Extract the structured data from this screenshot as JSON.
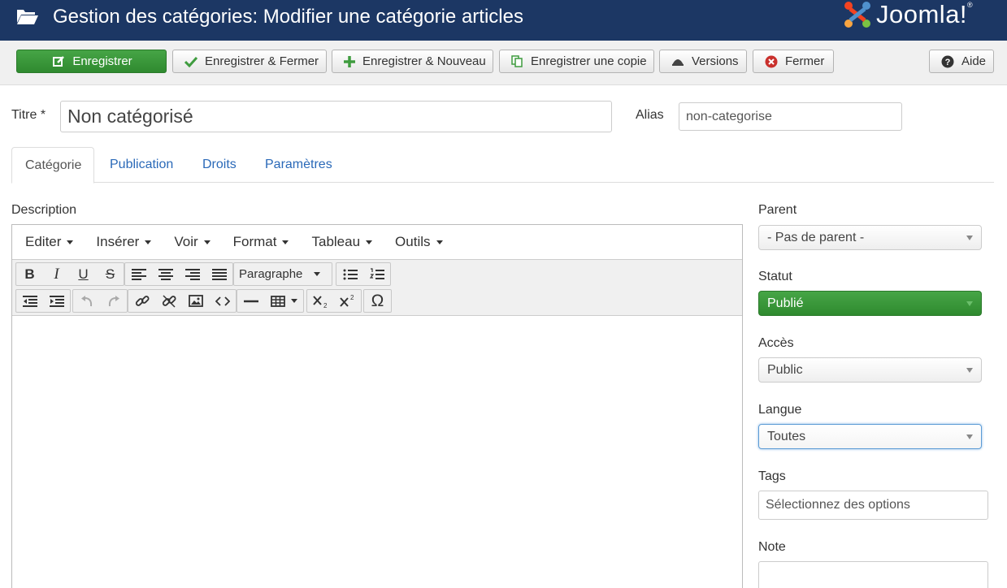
{
  "header": {
    "title": "Gestion des catégories: Modifier une catégorie articles",
    "logo_text": "Joomla!",
    "logo_reg": "®"
  },
  "toolbar": {
    "save": "Enregistrer",
    "save_close": "Enregistrer & Fermer",
    "save_new": "Enregistrer & Nouveau",
    "save_copy": "Enregistrer une copie",
    "versions": "Versions",
    "close": "Fermer",
    "help": "Aide"
  },
  "form": {
    "title_label": "Titre *",
    "title_value": "Non catégorisé",
    "alias_label": "Alias",
    "alias_value": "non-categorise"
  },
  "tabs": [
    "Catégorie",
    "Publication",
    "Droits",
    "Paramètres"
  ],
  "editor": {
    "label": "Description",
    "menus": [
      "Editer",
      "Insérer",
      "Voir",
      "Format",
      "Tableau",
      "Outils"
    ],
    "format_select": "Paragraphe",
    "bold": "B",
    "italic": "I",
    "underline": "U",
    "strike": "S",
    "omega": "Ω"
  },
  "sidebar": {
    "parent_label": "Parent",
    "parent_value": "- Pas de parent -",
    "status_label": "Statut",
    "status_value": "Publié",
    "access_label": "Accès",
    "access_value": "Public",
    "language_label": "Langue",
    "language_value": "Toutes",
    "tags_label": "Tags",
    "tags_placeholder": "Sélectionnez des options",
    "note_label": "Note"
  },
  "colors": {
    "header_bg": "#1c3764",
    "primary_green": "#3f9c3f",
    "link_blue": "#2a69b8"
  }
}
